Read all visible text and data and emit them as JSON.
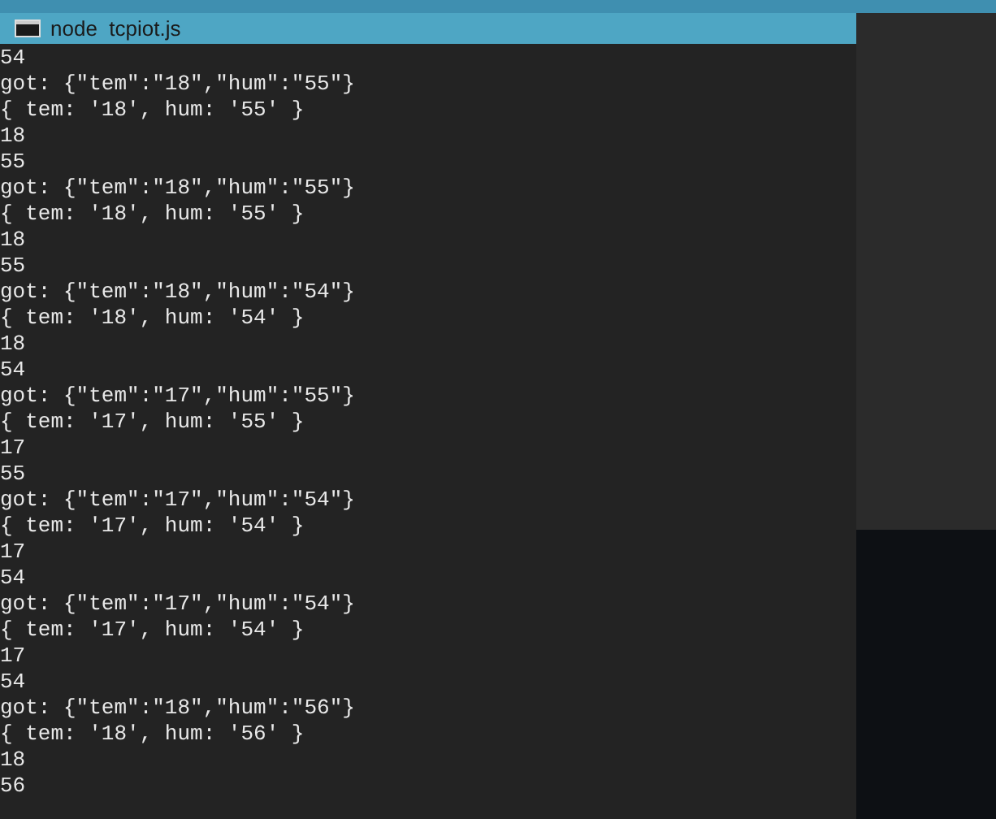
{
  "window": {
    "title": "node  tcpiot.js"
  },
  "console_lines": [
    "54",
    "got: {\"tem\":\"18\",\"hum\":\"55\"}",
    "{ tem: '18', hum: '55' }",
    "18",
    "55",
    "got: {\"tem\":\"18\",\"hum\":\"55\"}",
    "{ tem: '18', hum: '55' }",
    "18",
    "55",
    "got: {\"tem\":\"18\",\"hum\":\"54\"}",
    "{ tem: '18', hum: '54' }",
    "18",
    "54",
    "got: {\"tem\":\"17\",\"hum\":\"55\"}",
    "{ tem: '17', hum: '55' }",
    "17",
    "55",
    "got: {\"tem\":\"17\",\"hum\":\"54\"}",
    "{ tem: '17', hum: '54' }",
    "17",
    "54",
    "got: {\"tem\":\"17\",\"hum\":\"54\"}",
    "{ tem: '17', hum: '54' }",
    "17",
    "54",
    "got: {\"tem\":\"18\",\"hum\":\"56\"}",
    "{ tem: '18', hum: '56' }",
    "18",
    "56"
  ]
}
